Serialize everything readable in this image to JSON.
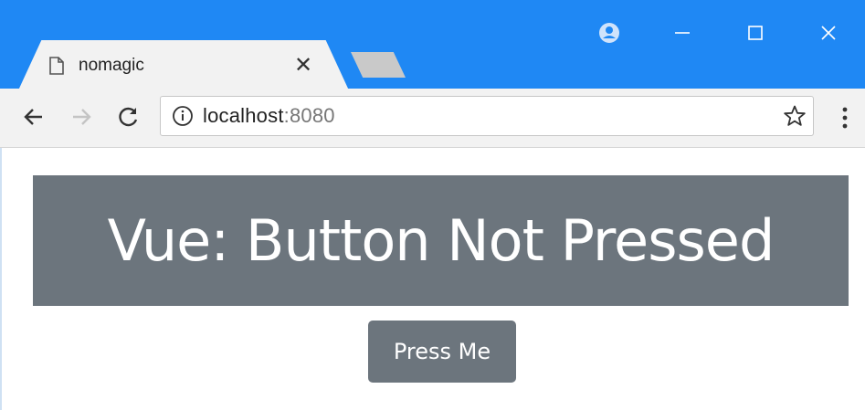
{
  "browser": {
    "tab": {
      "title": "nomagic",
      "close_glyph": "✕",
      "icon": "page-icon"
    },
    "new_tab_icon": "new-tab-icon",
    "window_controls": [
      "account-icon",
      "minimize-icon",
      "maximize-icon",
      "close-icon"
    ],
    "toolbar": {
      "back_icon": "arrow-left-icon",
      "forward_icon": "arrow-right-icon",
      "reload_icon": "reload-icon",
      "info_icon": "info-icon",
      "url_host": "localhost",
      "url_port": ":8080",
      "bookmark_icon": "star-icon",
      "menu_icon": "vertical-dots-icon"
    },
    "colors": {
      "titlebar": "#1f88f4",
      "toolbar": "#f2f2f2"
    }
  },
  "page": {
    "heading": "Vue: Button Not Pressed",
    "button_label": "Press Me",
    "colors": {
      "banner": "#6c757d",
      "button": "#6c757d",
      "text": "#ffffff"
    }
  }
}
